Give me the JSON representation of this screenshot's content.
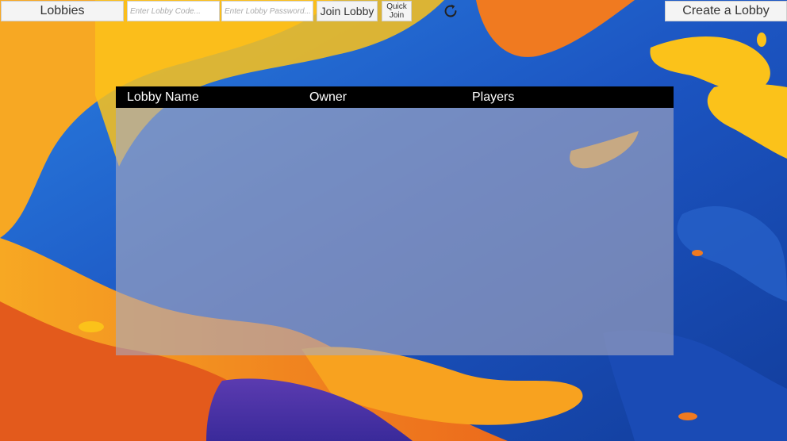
{
  "toolbar": {
    "lobbies_label": "Lobbies",
    "lobby_code_placeholder": "Enter Lobby Code...",
    "lobby_password_placeholder": "Enter Lobby Password...",
    "join_label": "Join Lobby",
    "quick_join_line1": "Quick",
    "quick_join_line2": "Join",
    "refresh_icon": "refresh-icon",
    "create_label": "Create a Lobby"
  },
  "lobby_table": {
    "columns": [
      "Lobby Name",
      "Owner",
      "Players"
    ],
    "rows": []
  },
  "theme": {
    "header_bg": "#000000",
    "panel_tint": "#aaaabe",
    "bg_blue": "#1f63c8",
    "bg_orange": "#f39a1e",
    "bg_yellow": "#fbc21a"
  }
}
